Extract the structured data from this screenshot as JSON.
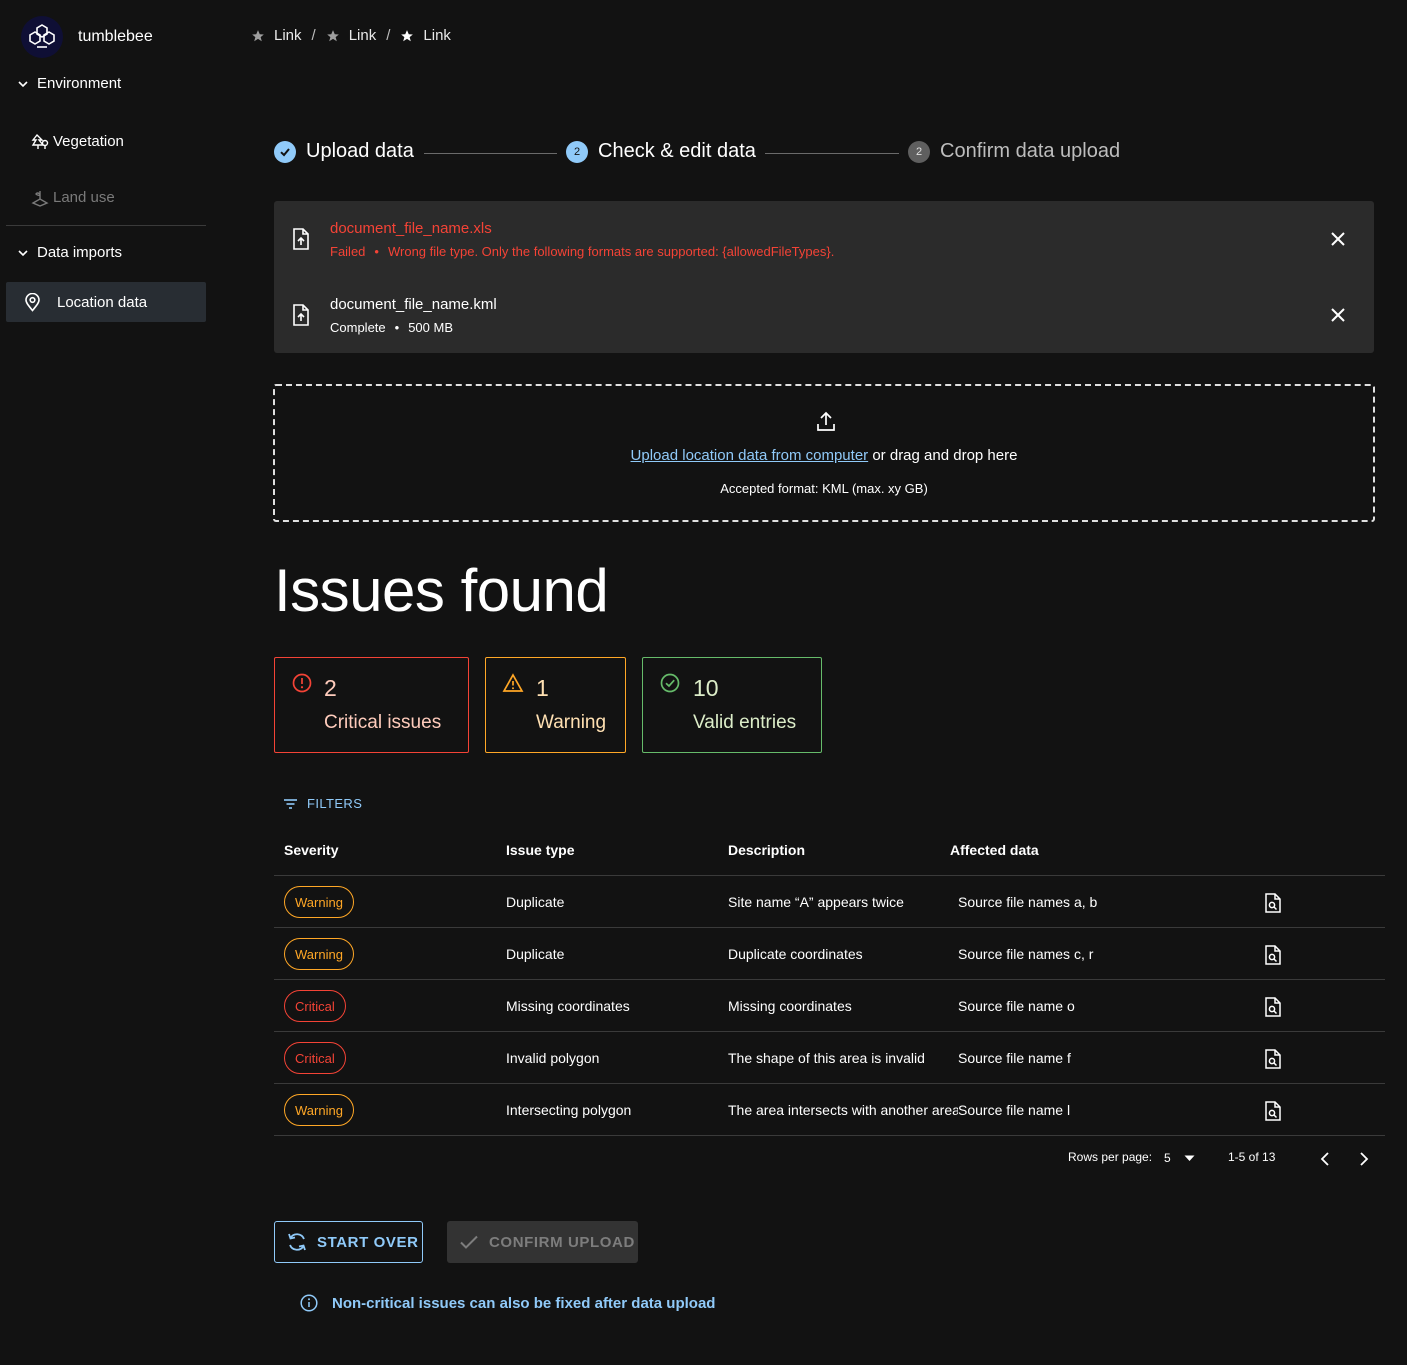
{
  "app": {
    "name": "tumblebee"
  },
  "sidebar": {
    "groups": [
      {
        "label": "Environment",
        "items": [
          {
            "label": "Vegetation",
            "icon": "tree-icon"
          },
          {
            "label": "Land use",
            "icon": "land-use-icon",
            "disabled": true
          }
        ]
      },
      {
        "label": "Data imports",
        "items": [
          {
            "label": "Location data",
            "icon": "location-pin-icon",
            "active": true
          }
        ]
      }
    ]
  },
  "breadcrumb": [
    {
      "label": "Link"
    },
    {
      "label": "Link"
    },
    {
      "label": "Link"
    }
  ],
  "breadcrumb_separator": "/",
  "stepper": {
    "steps": [
      {
        "label": "Upload data",
        "state": "completed"
      },
      {
        "number": "2",
        "label": "Check & edit data",
        "state": "active"
      },
      {
        "number": "2",
        "label": "Confirm data upload",
        "state": "inactive"
      }
    ]
  },
  "files": [
    {
      "name": "document_file_name.xls",
      "status": "Failed",
      "detail": "Wrong file type. Only the following formats are supported: {allowedFileTypes}.",
      "state": "error"
    },
    {
      "name": "document_file_name.kml",
      "status": "Complete",
      "detail": "500 MB",
      "state": "complete"
    }
  ],
  "file_meta_separator": "•",
  "dropzone": {
    "link": "Upload location data from computer",
    "text": "or drag and drop here",
    "format": "Accepted format: KML (max. xy GB)"
  },
  "issues": {
    "title": "Issues found",
    "summary": [
      {
        "count": "2",
        "label": "Critical issues",
        "kind": "critical"
      },
      {
        "count": "1",
        "label": "Warning",
        "kind": "warning"
      },
      {
        "count": "10",
        "label": "Valid entries",
        "kind": "valid"
      }
    ]
  },
  "filters_label": "FILTERS",
  "table": {
    "headers": [
      "Severity",
      "Issue type",
      "Description",
      "Affected data"
    ],
    "rows": [
      {
        "severity": "Warning",
        "issue_type": "Duplicate",
        "description": "Site name “A” appears twice",
        "affected": "Source file names a, b"
      },
      {
        "severity": "Warning",
        "issue_type": "Duplicate",
        "description": "Duplicate coordinates",
        "affected": "Source file names c, r"
      },
      {
        "severity": "Critical",
        "issue_type": "Missing coordinates",
        "description": "Missing coordinates",
        "affected": "Source file name o"
      },
      {
        "severity": "Critical",
        "issue_type": "Invalid polygon",
        "description": "The shape of this area is invalid",
        "affected": "Source file name f"
      },
      {
        "severity": "Warning",
        "issue_type": "Intersecting polygon",
        "description": "The area intersects with another area",
        "affected": "Source file name l"
      }
    ]
  },
  "pagination": {
    "rows_label": "Rows per page:",
    "rows_value": "5",
    "range": "1-5 of 13"
  },
  "buttons": {
    "start_over": "START OVER",
    "confirm_upload": "CONFIRM UPLOAD"
  },
  "info_text": "Non-critical issues can also be fixed after data upload",
  "colors": {
    "accent": "#90caf9",
    "error": "#f44336",
    "warning": "#ffa726",
    "success": "#66bb6a",
    "background": "#121212"
  }
}
